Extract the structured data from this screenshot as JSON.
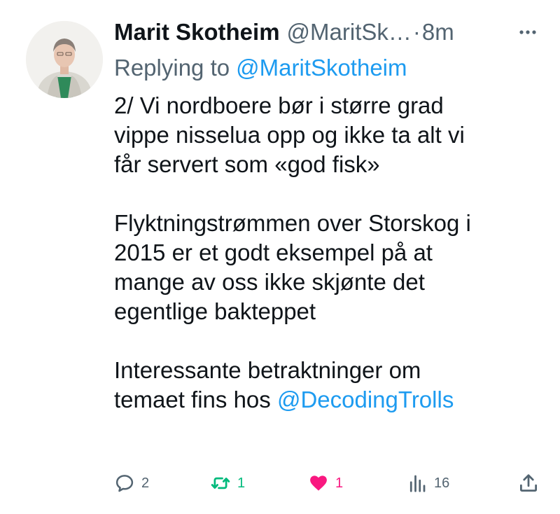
{
  "tweet": {
    "author": {
      "name": "Marit Skotheim",
      "handle": "@MaritSk…",
      "separator": "·",
      "timestamp": "8m"
    },
    "replying_to": {
      "prefix": "Replying to",
      "mention": "@MaritSkotheim"
    },
    "body": {
      "para1_lines": [
        "2/ Vi nordboere bør i større grad",
        "vippe nisselua opp og ikke ta alt vi",
        "får servert som «god fisk»"
      ],
      "para2_lines": [
        "Flyktningstrømmen over Storskog i",
        "2015 er et godt eksempel på at",
        "mange av oss ikke skjønte det",
        "egentlige bakteppet"
      ],
      "para3_line1": "Interessante betraktninger om",
      "para3_line2_prefix": "temaet fins hos ",
      "para3_mention": "@DecodingTrolls"
    },
    "actions": {
      "replies": "2",
      "retweets": "1",
      "likes": "1",
      "views": "16"
    }
  },
  "colors": {
    "text": "#0f1419",
    "secondary": "#536471",
    "link": "#1d9bf0",
    "retweet": "#00ba7c",
    "like": "#f91880"
  },
  "icons": {
    "more": "more-dots-icon",
    "reply": "reply-bubble-icon",
    "retweet": "retweet-arrows-icon",
    "like": "heart-filled-icon",
    "views": "bar-chart-icon",
    "share": "share-upload-icon"
  }
}
